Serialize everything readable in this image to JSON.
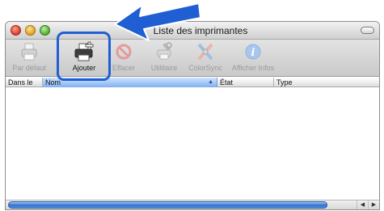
{
  "window": {
    "title": "Liste des imprimantes"
  },
  "toolbar": {
    "items": [
      {
        "label": "Par défaut",
        "icon": "printer-default-icon",
        "enabled": false
      },
      {
        "label": "Ajouter",
        "icon": "add-printer-icon",
        "enabled": true
      },
      {
        "label": "Effacer",
        "icon": "delete-icon",
        "enabled": false
      },
      {
        "label": "Utilitaire",
        "icon": "utility-icon",
        "enabled": false
      },
      {
        "label": "ColorSync",
        "icon": "colorsync-icon",
        "enabled": false
      },
      {
        "label": "Afficher Infos",
        "icon": "info-icon",
        "enabled": false
      }
    ]
  },
  "columns": {
    "dans_le": "Dans le",
    "nom": "Nom",
    "etat": "État",
    "type": "Type"
  },
  "colors": {
    "highlight": "#1f5fd3",
    "arrow": "#1f5fd3"
  }
}
